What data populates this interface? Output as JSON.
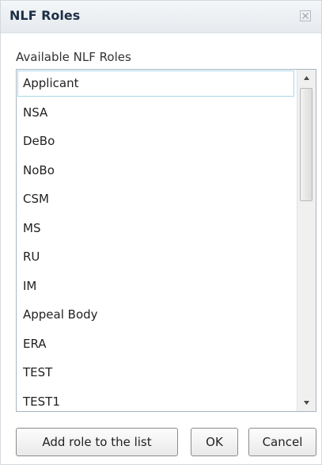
{
  "dialog": {
    "title": "NLF Roles",
    "close_icon": "close-icon"
  },
  "roles_section": {
    "label": "Available NLF Roles",
    "selected_index": 0,
    "items": [
      {
        "label": "Applicant"
      },
      {
        "label": "NSA"
      },
      {
        "label": "DeBo"
      },
      {
        "label": "NoBo"
      },
      {
        "label": "CSM"
      },
      {
        "label": "MS"
      },
      {
        "label": "RU"
      },
      {
        "label": "IM"
      },
      {
        "label": "Appeal Body"
      },
      {
        "label": "ERA"
      },
      {
        "label": "TEST"
      },
      {
        "label": "TEST1"
      }
    ],
    "scroll": {
      "thumb_start_fraction": 0.0,
      "thumb_size_fraction": 0.37
    }
  },
  "buttons": {
    "add_role": "Add role to the list",
    "ok": "OK",
    "cancel": "Cancel"
  },
  "colors": {
    "title_text": "#1d2f46",
    "selected_border": "#a8d7e6",
    "list_border": "#a9b4c1"
  }
}
